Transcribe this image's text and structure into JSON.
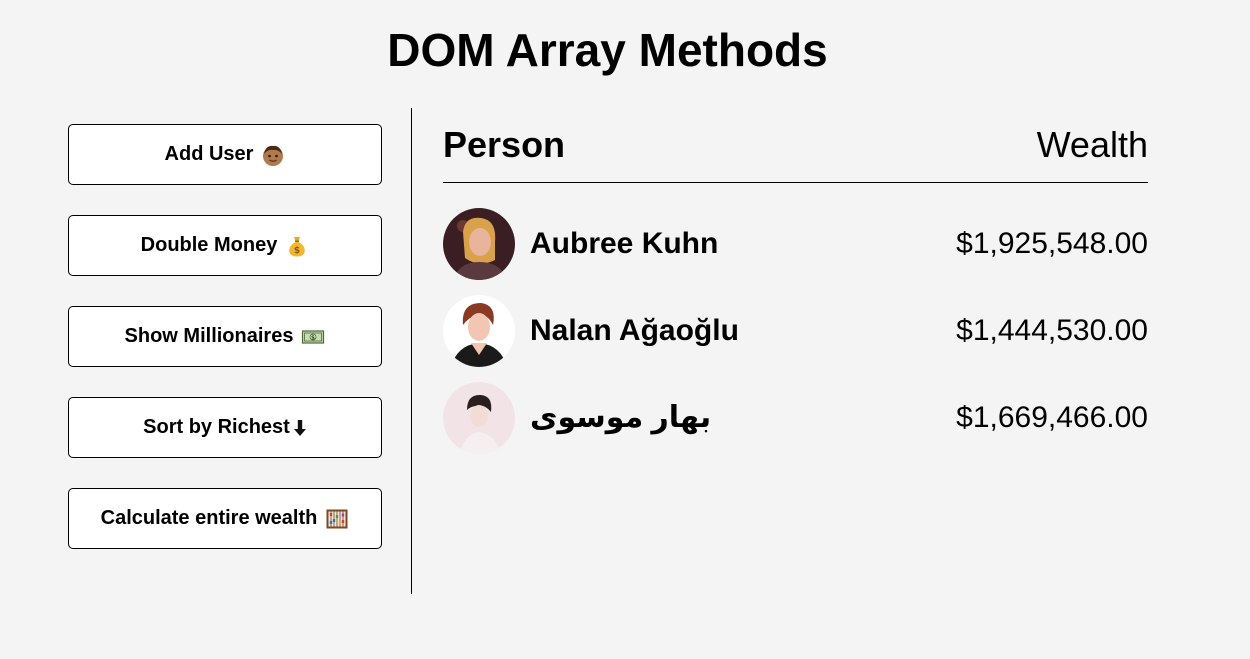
{
  "page": {
    "title": "DOM Array Methods"
  },
  "buttons": [
    {
      "label": "Add User",
      "icon": "boy-face-icon"
    },
    {
      "label": "Double Money",
      "icon": "money-bag-icon"
    },
    {
      "label": "Show Millionaires",
      "icon": "dollar-banknote-icon"
    },
    {
      "label": "Sort by Richest",
      "icon": "down-arrow-icon"
    },
    {
      "label": "Calculate entire wealth",
      "icon": "abacus-icon"
    }
  ],
  "table": {
    "header_person": "Person",
    "header_wealth": "Wealth",
    "rows": [
      {
        "name": "Aubree Kuhn",
        "wealth": "$1,925,548.00"
      },
      {
        "name": "Nalan Ağaoğlu",
        "wealth": "$1,444,530.00"
      },
      {
        "name": "بهار موسوی",
        "wealth": "$1,669,466.00"
      }
    ]
  },
  "colors": {
    "background": "#f4f4f4",
    "button_bg": "#ffffff",
    "text": "#000000"
  }
}
